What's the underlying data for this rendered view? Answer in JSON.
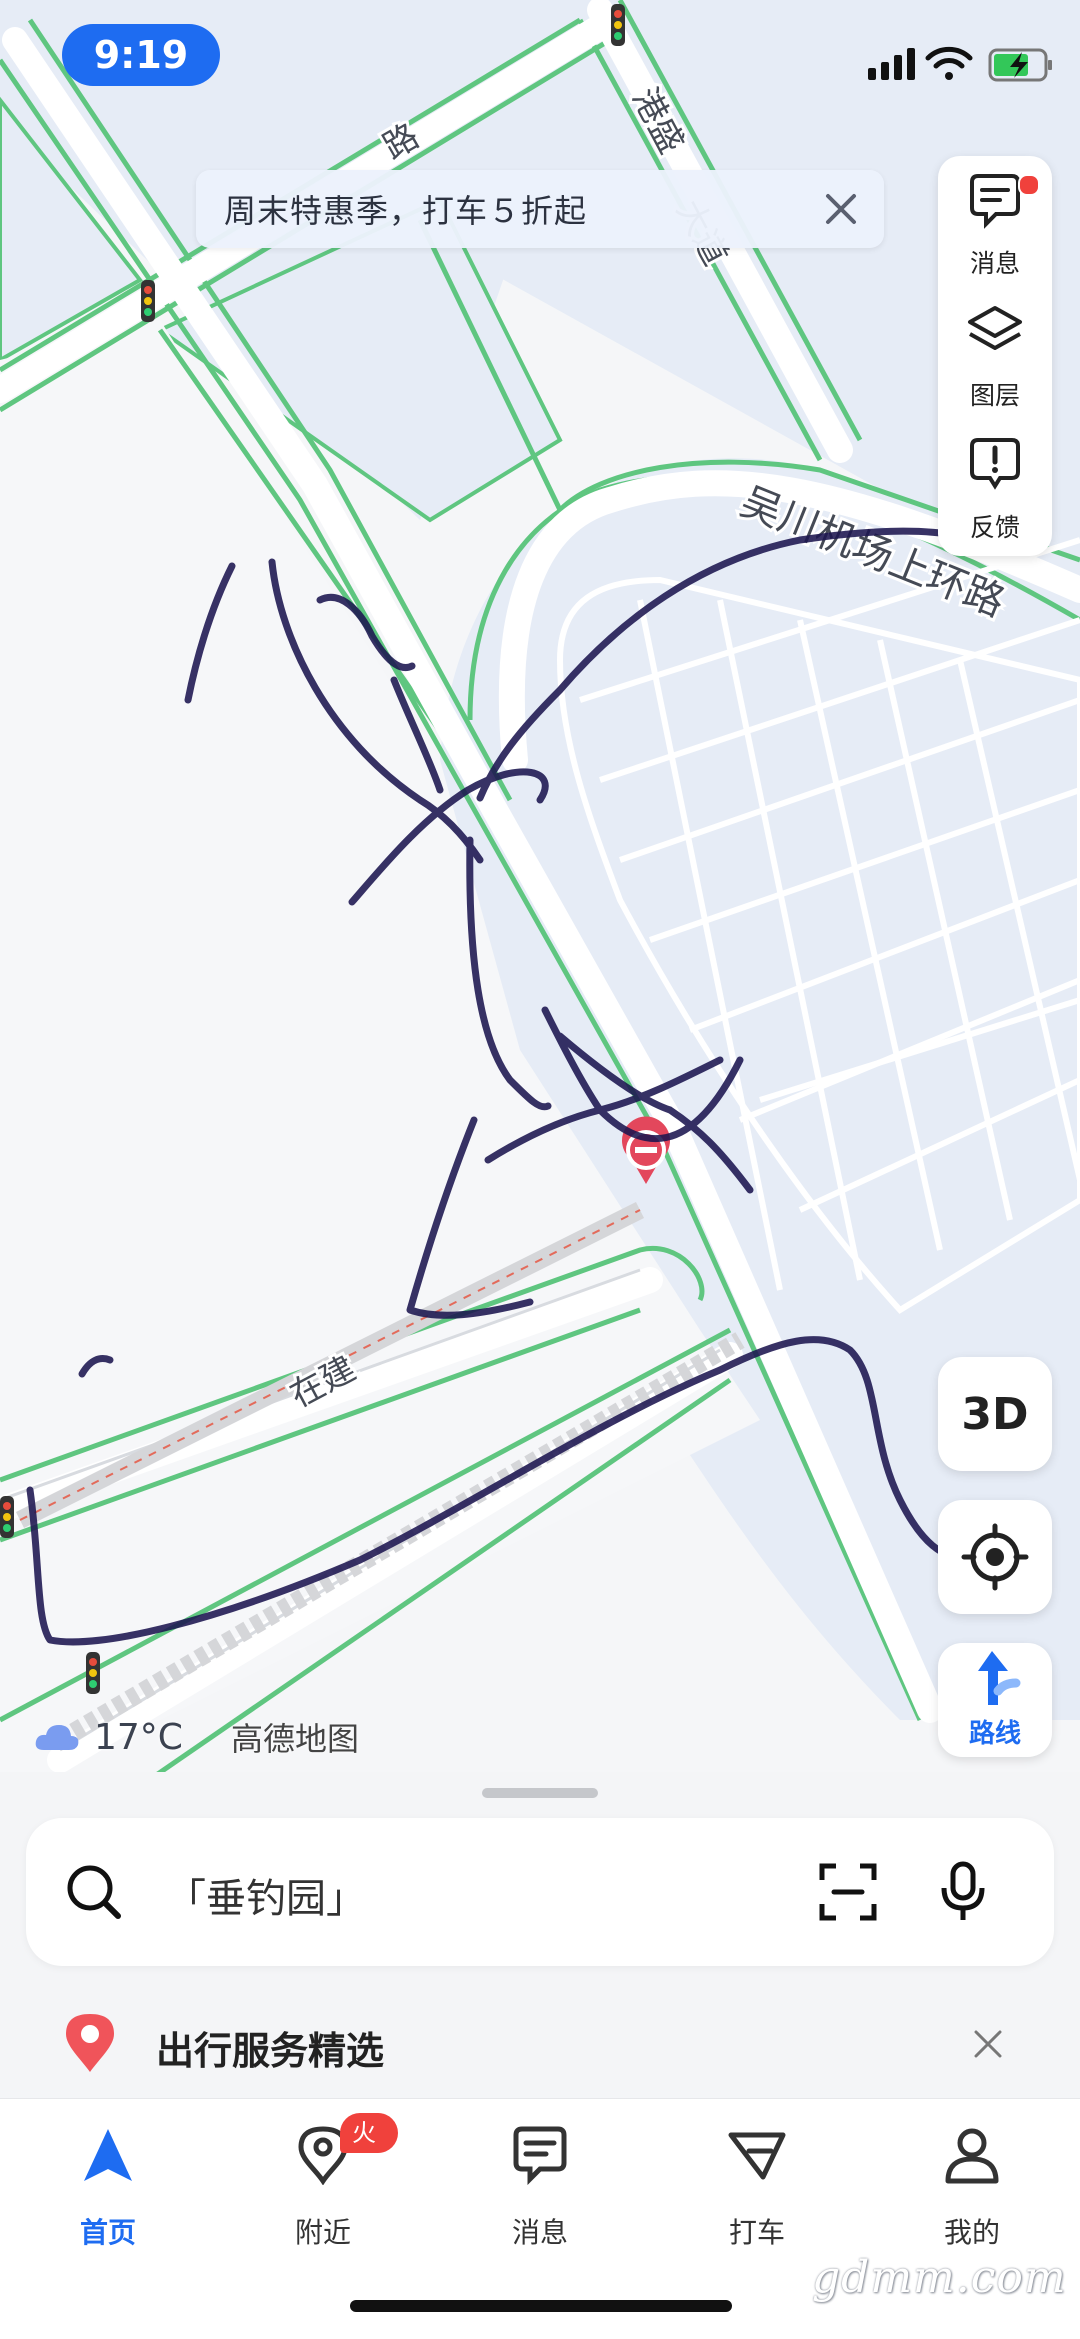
{
  "status_bar": {
    "time": "9:19"
  },
  "promo": {
    "text": "周末特惠季，打车５折起"
  },
  "map": {
    "road_labels": [
      "港盛",
      "路",
      "大道",
      "吴川机场上环路",
      "在建"
    ],
    "weather": {
      "temperature": "17°C"
    },
    "brand": "高德地图"
  },
  "side_panel": {
    "messages": "消息",
    "layers": "图层",
    "feedback": "反馈"
  },
  "buttons": {
    "three_d": "3D",
    "route": "路线"
  },
  "search": {
    "placeholder": "「垂钓园」"
  },
  "service": {
    "title": "出行服务精选"
  },
  "tabs": [
    {
      "label": "首页"
    },
    {
      "label": "附近",
      "badge": "火锅"
    },
    {
      "label": "消息"
    },
    {
      "label": "打车"
    },
    {
      "label": "我的"
    }
  ],
  "watermark": "gdmm.com",
  "colors": {
    "accent": "#1e6cf1",
    "road_green": "#5fc680",
    "water": "#e6ecf6",
    "scribble": "#1c1650",
    "badge_red": "#f0413c"
  }
}
